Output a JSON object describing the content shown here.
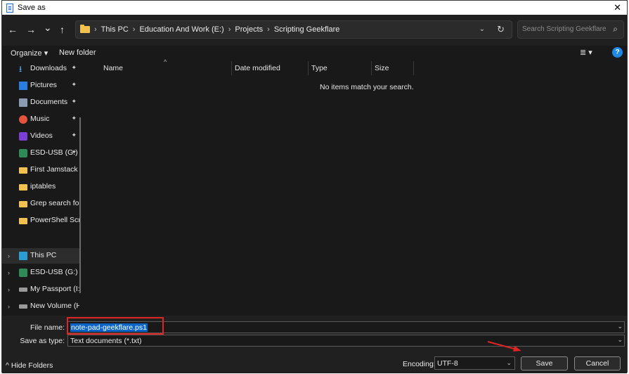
{
  "window": {
    "title": "Save as",
    "close_glyph": "✕"
  },
  "nav": {
    "back": "←",
    "forward": "→",
    "recent": "⌄",
    "up": "↑",
    "breadcrumbs": [
      "This PC",
      "Education And Work (E:)",
      "Projects",
      "Scripting Geekflare"
    ],
    "separator": "›",
    "dropdown": "⌄",
    "refresh": "↻",
    "search_placeholder": "Search Scripting Geekflare",
    "search_icon": "⌕"
  },
  "toolbar": {
    "organize": "Organize ▾",
    "new_folder": "New folder",
    "view_icon": "≣ ▾",
    "help": "?"
  },
  "sidebar": {
    "items": [
      {
        "label": "Downloads",
        "icon": "download-icon",
        "pinned": true
      },
      {
        "label": "Pictures",
        "icon": "pictures-icon",
        "pinned": true
      },
      {
        "label": "Documents",
        "icon": "documents-icon",
        "pinned": true
      },
      {
        "label": "Music",
        "icon": "music-icon",
        "pinned": true
      },
      {
        "label": "Videos",
        "icon": "videos-icon",
        "pinned": true
      },
      {
        "label": "ESD-USB (G:)",
        "icon": "usb-drive-icon",
        "pinned": true
      },
      {
        "label": "First Jamstack w",
        "icon": "folder-icon",
        "pinned": false
      },
      {
        "label": "iptables",
        "icon": "folder-icon",
        "pinned": false
      },
      {
        "label": "Grep search for",
        "icon": "folder-icon",
        "pinned": false
      },
      {
        "label": "PowerShell Scrip",
        "icon": "folder-icon",
        "pinned": false
      },
      {
        "label": "This PC",
        "icon": "computer-icon",
        "expandable": true
      },
      {
        "label": "ESD-USB (G:)",
        "icon": "usb-drive-icon",
        "expandable": true
      },
      {
        "label": "My Passport (I:)",
        "icon": "drive-icon",
        "expandable": true
      },
      {
        "label": "New Volume (H",
        "icon": "drive-icon",
        "expandable": true
      }
    ],
    "pin_glyph": "✦",
    "expand_glyph": "›"
  },
  "content": {
    "columns": [
      "Name",
      "Date modified",
      "Type",
      "Size"
    ],
    "sort_glyph": "^",
    "empty_message": "No items match your search."
  },
  "form": {
    "filename_label": "File name:",
    "filename_value": "note-pad-geekflare.ps1",
    "savetype_label": "Save as type:",
    "savetype_value": "Text documents (*.txt)",
    "dropdown": "⌄"
  },
  "footer": {
    "hide_folders": "Hide Folders",
    "hide_glyph": "^",
    "encoding_label": "Encoding:",
    "encoding_value": "UTF-8",
    "save_button": "Save",
    "cancel_button": "Cancel"
  },
  "colors": {
    "accent": "#0a64c8",
    "highlight_box": "#e02424",
    "annotation_arrow": "#e02424"
  }
}
